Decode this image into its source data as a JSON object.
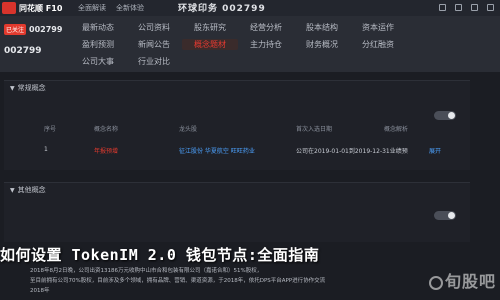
{
  "topbar": {
    "brand": "同花顺 F10",
    "nav_left": [
      "全面解读",
      "全新体验"
    ],
    "banner": "环球印务 002799"
  },
  "stock": {
    "badge": "已关注",
    "code_small": "002799",
    "code_large": "002799"
  },
  "nav": {
    "row1": [
      "最新动态",
      "公司资料",
      "股东研究",
      "经营分析",
      "股本结构",
      "资本运作"
    ],
    "row2": [
      "盈利预测",
      "新闻公告",
      "概念题材",
      "主力持仓",
      "财务概况",
      "分红融资"
    ],
    "row3": [
      "公司大事",
      "行业对比",
      "",
      "",
      "",
      ""
    ],
    "active_label": "概念题材"
  },
  "panel1": {
    "title": "常规概念",
    "headers": [
      "序号",
      "概念名称",
      "龙头股",
      "首次入选日期",
      "概念解析"
    ],
    "rows": [
      {
        "seq": "1",
        "concept": "年报预增",
        "leaders": "征江股份 华夏航空 旺旺药业",
        "date": "公司在2019-01-01到2019-12-31业绩预",
        "action": "展开"
      }
    ]
  },
  "panel2": {
    "title": "其他概念"
  },
  "overlay": {
    "title": "如何设置 TokenIM 2.0 钱包节点:全面指南"
  },
  "footnote": {
    "line1": "2018年8月2日晚，公司出资13186万元收购中山市合和包装有限公司（嘉诺合和）51%股权，",
    "line2": "至目前拥有公司70%股权，目前涉及多个领域，拥有品牌、营销、渠道资源，于2018年，依托DPS平台APP进行协作交流",
    "line3": "2018年"
  },
  "watermark": "旬股吧"
}
